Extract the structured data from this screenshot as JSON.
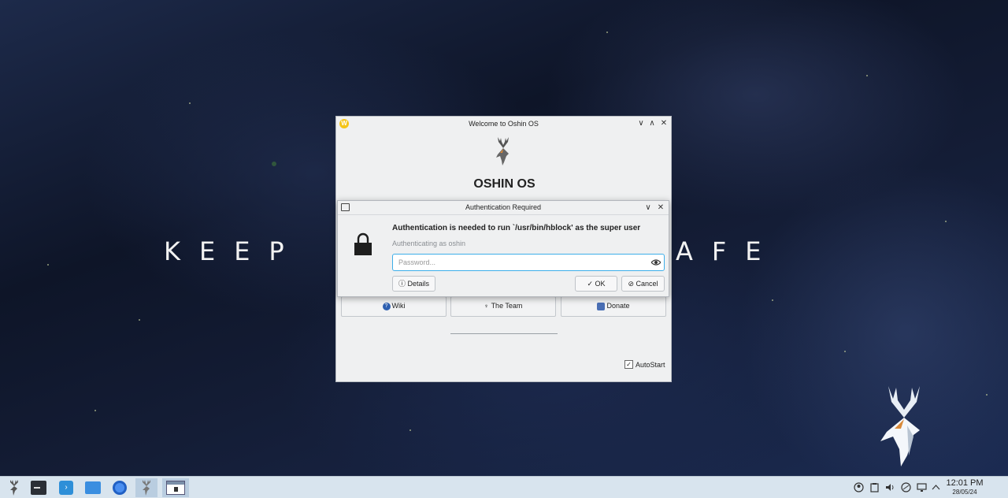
{
  "desktop": {
    "slogan_left": "KEEP",
    "slogan_right": "AFE"
  },
  "welcome_window": {
    "title": "Welcome to Oshin OS",
    "heading": "OSHIN OS",
    "buttons": {
      "wiki": "Wiki",
      "team": "The Team",
      "donate": "Donate"
    },
    "autostart_label": "AutoStart",
    "autostart_checked": "✓",
    "controls": {
      "minimize": "∨",
      "maximize": "∧",
      "close": "✕"
    }
  },
  "auth_dialog": {
    "title": "Authentication Required",
    "heading": "Authentication is needed to run `/usr/bin/hblock' as the super user",
    "subtext": "Authenticating as oshin",
    "password_placeholder": "Password...",
    "details_label": "Details",
    "ok_label": "OK",
    "cancel_label": "Cancel",
    "controls": {
      "minimize": "∨",
      "close": "✕"
    }
  },
  "taskbar": {
    "items": [
      "app-launcher",
      "terminal",
      "discover",
      "file-manager",
      "chromium",
      "oshin-welcome",
      "auth-window"
    ],
    "clock_time": "12:01 PM",
    "clock_date": "28/05/24",
    "tray_icons": [
      "updates-icon",
      "clipboard-icon",
      "volume-icon",
      "network-icon",
      "power-icon",
      "display-icon",
      "expand-tray-icon"
    ]
  },
  "colors": {
    "accent": "#3daee9",
    "taskbar_bg": "#d8e4ee",
    "window_bg": "#eff0f1"
  }
}
